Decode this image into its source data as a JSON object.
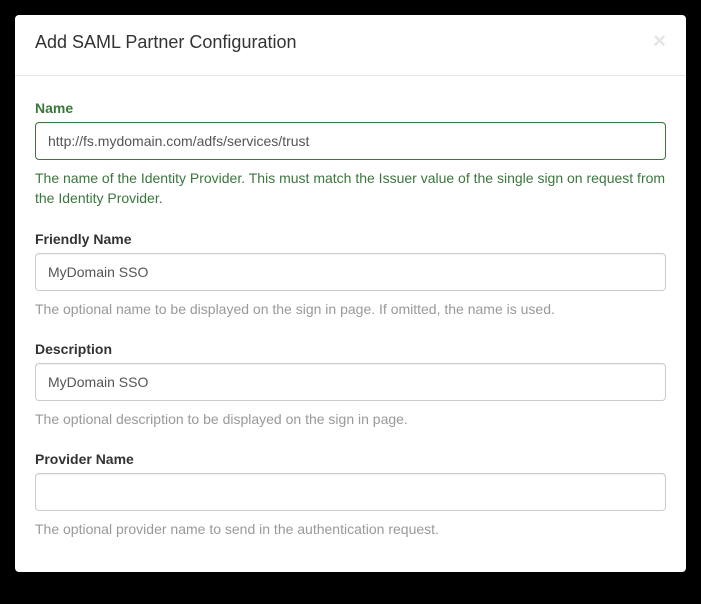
{
  "modal": {
    "title": "Add SAML Partner Configuration"
  },
  "form": {
    "name": {
      "label": "Name",
      "value": "http://fs.mydomain.com/adfs/services/trust",
      "help": "The name of the Identity Provider. This must match the Issuer value of the single sign on request from the Identity Provider."
    },
    "friendlyName": {
      "label": "Friendly Name",
      "value": "MyDomain SSO",
      "help": "The optional name to be displayed on the sign in page. If omitted, the name is used."
    },
    "description": {
      "label": "Description",
      "value": "MyDomain SSO",
      "help": "The optional description to be displayed on the sign in page."
    },
    "providerName": {
      "label": "Provider Name",
      "value": "",
      "help": "The optional provider name to send in the authentication request."
    }
  }
}
